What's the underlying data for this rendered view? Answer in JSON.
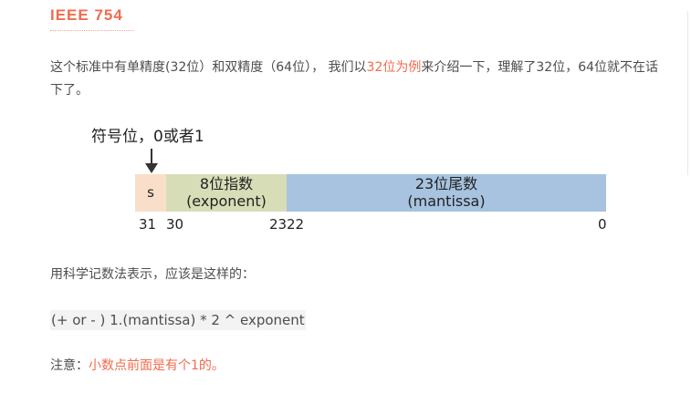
{
  "heading": "IEEE 754",
  "intro": {
    "part1": "这个标准中有单精度(32位）和双精度（64位），  我们以",
    "highlight": "32位为例",
    "part2": "来介绍一下，理解了32位，64位就不在话下了。"
  },
  "figure": {
    "sign_label": "符号位，0或者1",
    "sign_field": "s",
    "exponent_field": {
      "line1": "8位指数",
      "line2": "(exponent)"
    },
    "mantissa_field": {
      "line1": "23位尾数",
      "line2": "(mantissa)"
    },
    "bit_labels": {
      "b31": "31",
      "b30": "30",
      "b23": "23",
      "b22": "22",
      "b0": "0"
    },
    "colors": {
      "sign": "#f9dfc9",
      "exponent": "#d7deb7",
      "mantissa": "#a7c3df"
    }
  },
  "sci_notation_text": "用科学记数法表示，应该是这样的：",
  "formula": "(+ or - ) 1.(mantissa) * 2 ^ exponent",
  "note": {
    "label": "注意：",
    "highlight": "小数点前面是有个1的。"
  },
  "colors": {
    "accent": "#f06b4e",
    "text": "#4d4d4d"
  }
}
